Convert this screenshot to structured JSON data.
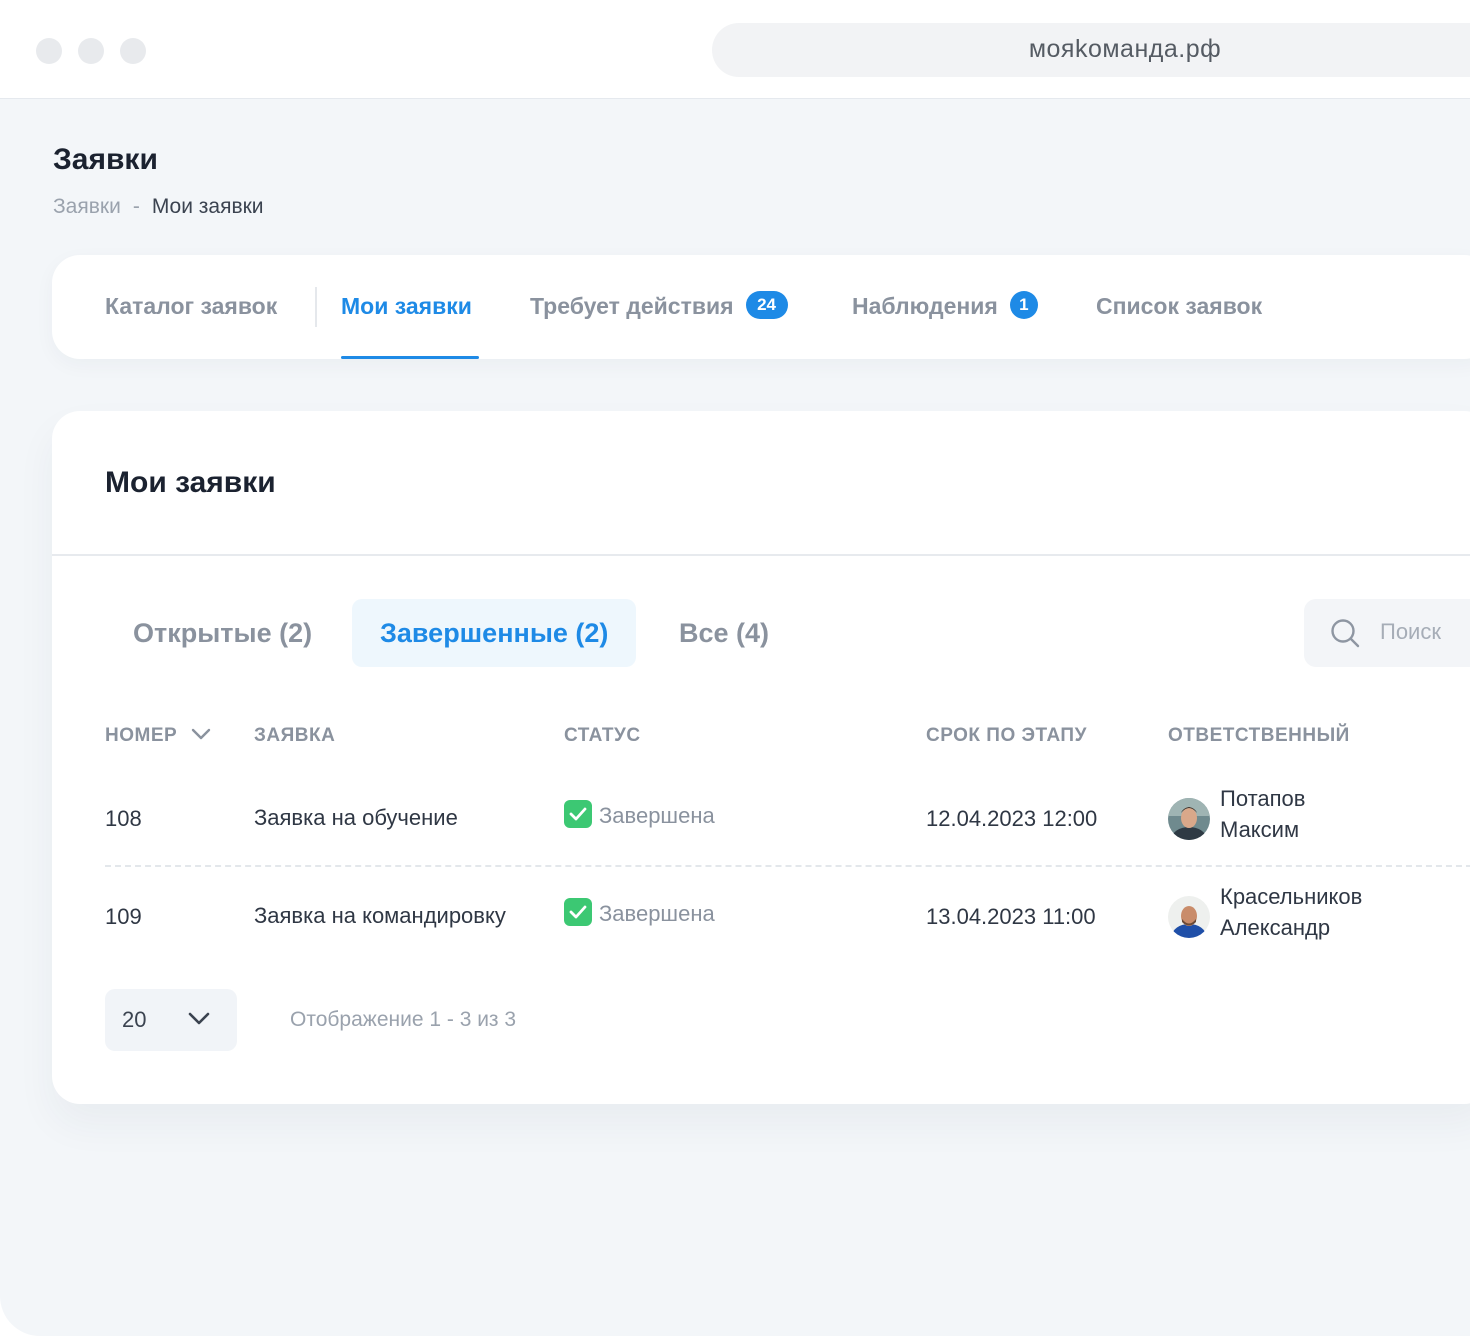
{
  "browser": {
    "url": "мояkоманда.рф"
  },
  "page": {
    "title": "Заявки"
  },
  "breadcrumb": {
    "parent": "Заявки",
    "separator": "-",
    "current": "Мои заявки"
  },
  "tabs": [
    {
      "label": "Каталог заявок"
    },
    {
      "label": "Мои заявки",
      "active": true
    },
    {
      "label": "Требует действия",
      "badge": "24"
    },
    {
      "label": "Наблюдения",
      "badge": "1"
    },
    {
      "label": "Список заявок"
    }
  ],
  "card": {
    "title": "Мои заявки"
  },
  "filters": [
    {
      "label": "Открытые (2)"
    },
    {
      "label": "Завершенные (2)",
      "active": true
    },
    {
      "label": "Все (4)"
    }
  ],
  "search": {
    "placeholder": "Поиск",
    "icon": "search-icon"
  },
  "table": {
    "headers": [
      "НОМЕР",
      "ЗАЯВКА",
      "СТАТУС",
      "СРОК ПО ЭТАПУ",
      "ОТВЕТСТВЕННЫЙ"
    ],
    "rows": [
      {
        "number": "108",
        "request": "Заявка на обучение",
        "status": "Завершена",
        "deadline": "12.04.2023 12:00",
        "responsible_first": "Потапов",
        "responsible_second": "Максим"
      },
      {
        "number": "109",
        "request": "Заявка на командировку",
        "status": "Завершена",
        "deadline": "13.04.2023 11:00",
        "responsible_first": "Красельников",
        "responsible_second": "Александр"
      }
    ]
  },
  "pagination": {
    "per_page": "20",
    "info": "Отображение 1 - 3 из 3"
  },
  "colors": {
    "accent": "#1e8ae6",
    "success": "#3cc873",
    "muted": "#8a929e",
    "text": "#1b2230"
  }
}
